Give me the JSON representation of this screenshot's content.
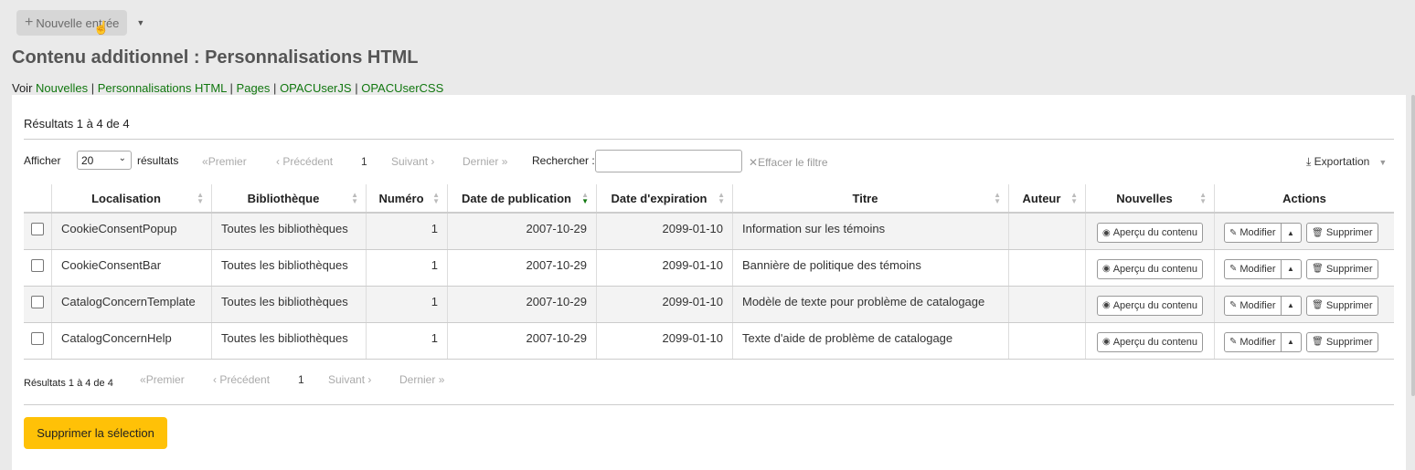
{
  "toolbar": {
    "new_entry": "Nouvelle entrée"
  },
  "page": {
    "title": "Contenu additionnel : Personnalisations HTML"
  },
  "see_links": {
    "prefix": "Voir",
    "items": [
      "Nouvelles",
      "Personnalisations HTML",
      "Pages",
      "OPACUserJS",
      "OPACUserCSS"
    ]
  },
  "results_summary": "Résultats 1 à 4 de 4",
  "controls": {
    "show_label": "Afficher",
    "page_size": "20",
    "results_label": "résultats",
    "first": "Premier",
    "previous": "Précédent",
    "current_page": "1",
    "next": "Suivant",
    "last": "Dernier",
    "search_label": "Rechercher :",
    "search_value": "",
    "clear_filter": "Effacer le filtre",
    "export": "Exportation"
  },
  "table": {
    "columns": [
      "Localisation",
      "Bibliothèque",
      "Numéro",
      "Date de publication",
      "Date d'expiration",
      "Titre",
      "Auteur",
      "Nouvelles",
      "Actions"
    ],
    "rows": [
      {
        "location": "CookieConsentPopup",
        "library": "Toutes les bibliothèques",
        "number": "1",
        "pub_date": "2007-10-29",
        "exp_date": "2099-01-10",
        "title": "Information sur les témoins",
        "author": ""
      },
      {
        "location": "CookieConsentBar",
        "library": "Toutes les bibliothèques",
        "number": "1",
        "pub_date": "2007-10-29",
        "exp_date": "2099-01-10",
        "title": "Bannière de politique des témoins",
        "author": ""
      },
      {
        "location": "CatalogConcernTemplate",
        "library": "Toutes les bibliothèques",
        "number": "1",
        "pub_date": "2007-10-29",
        "exp_date": "2099-01-10",
        "title": "Modèle de texte pour problème de catalogage",
        "author": ""
      },
      {
        "location": "CatalogConcernHelp",
        "library": "Toutes les bibliothèques",
        "number": "1",
        "pub_date": "2007-10-29",
        "exp_date": "2099-01-10",
        "title": "Texte d'aide de problème de catalogage",
        "author": ""
      }
    ],
    "preview_label": "Aperçu du contenu",
    "edit_label": "Modifier",
    "delete_label": "Supprimer"
  },
  "delete_selection": "Supprimer la sélection",
  "colors": {
    "accent_link": "#11770f",
    "warning_button": "#ffc107"
  }
}
